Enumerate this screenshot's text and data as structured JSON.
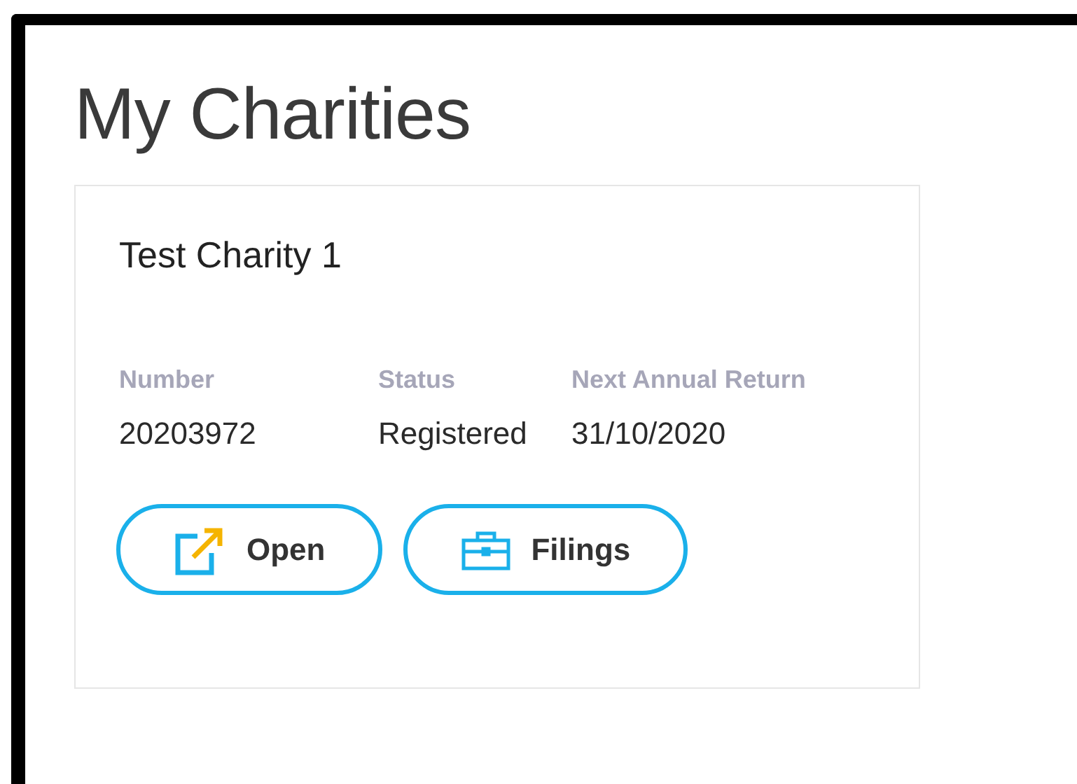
{
  "page": {
    "title": "My Charities"
  },
  "charities": [
    {
      "name": "Test Charity 1",
      "fields": [
        {
          "label": "Number",
          "value": "20203972"
        },
        {
          "label": "Status",
          "value": "Registered"
        },
        {
          "label": "Next Annual Return",
          "value": "31/10/2020"
        }
      ],
      "actions": [
        {
          "label": "Open"
        },
        {
          "label": "Filings"
        }
      ]
    }
  ]
}
